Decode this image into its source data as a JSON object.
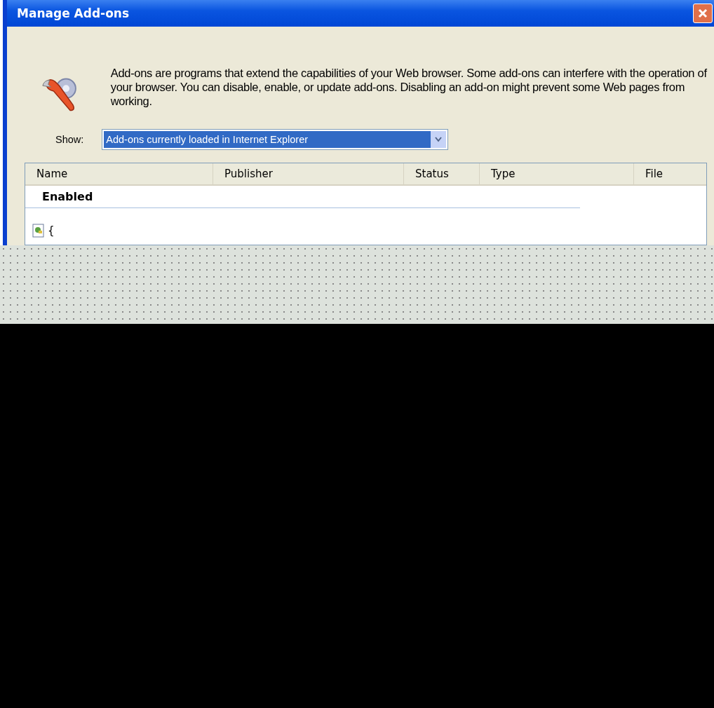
{
  "window": {
    "title": "Manage Add-ons"
  },
  "description": "Add-ons are programs that extend the capabilities of your Web browser. Some add-ons can interfere with the operation of your browser. You can disable, enable, or update add-ons. Disabling an add-on might prevent some Web pages from working.",
  "show": {
    "label": "Show:",
    "value": "Add-ons currently loaded in Internet Explorer"
  },
  "table": {
    "columns": [
      "Name",
      "Publisher",
      "Status",
      "Type",
      "File"
    ],
    "groups": [
      {
        "title": "Enabled",
        "rows": [
          {
            "name": "{"
          }
        ]
      }
    ]
  }
}
